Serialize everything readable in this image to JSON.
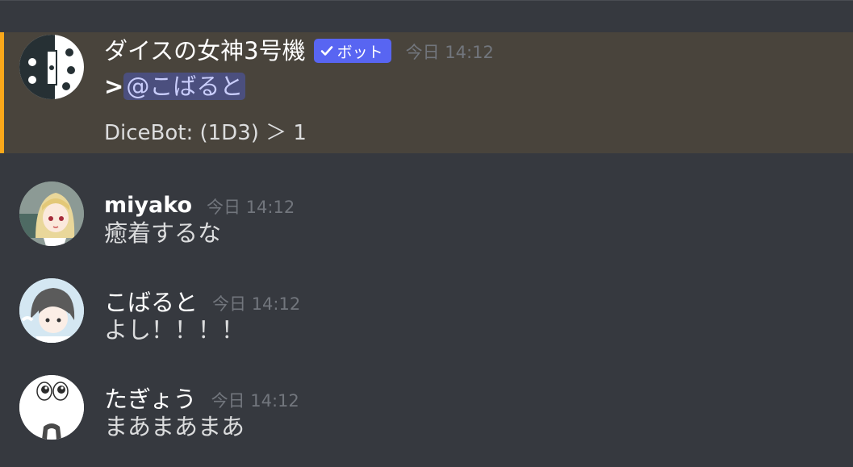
{
  "colors": {
    "background": "#36393f",
    "mention_highlight_bg": "#49443c",
    "mention_bar": "#faa81a",
    "bot_tag": "#5865f2",
    "timestamp": "#72767d",
    "message_text": "#dcddde",
    "mention_chip_bg": "#4b4f7e",
    "mention_chip_text": "#c9cdfb"
  },
  "messages": [
    {
      "username": "ダイスの女神3号機",
      "bot_tag": "ボット",
      "bot_tag_icon": "checkmark-icon",
      "timestamp": "今日 14:12",
      "quote_mark": ">",
      "mention": "@こばると",
      "result": "DiceBot: (1D3) ＞ 1",
      "avatar_icon": "dice-avatar"
    },
    {
      "username": "miyako",
      "timestamp": "今日 14:12",
      "text": "癒着するな",
      "avatar_icon": "anime-girl-avatar"
    },
    {
      "username": "こばると",
      "timestamp": "今日 14:12",
      "text": "よし！！！！",
      "avatar_icon": "anime-boy-avatar"
    },
    {
      "username": "たぎょう",
      "timestamp": "今日 14:12",
      "text": "まあまあまあ",
      "avatar_icon": "surprised-face-avatar"
    }
  ]
}
